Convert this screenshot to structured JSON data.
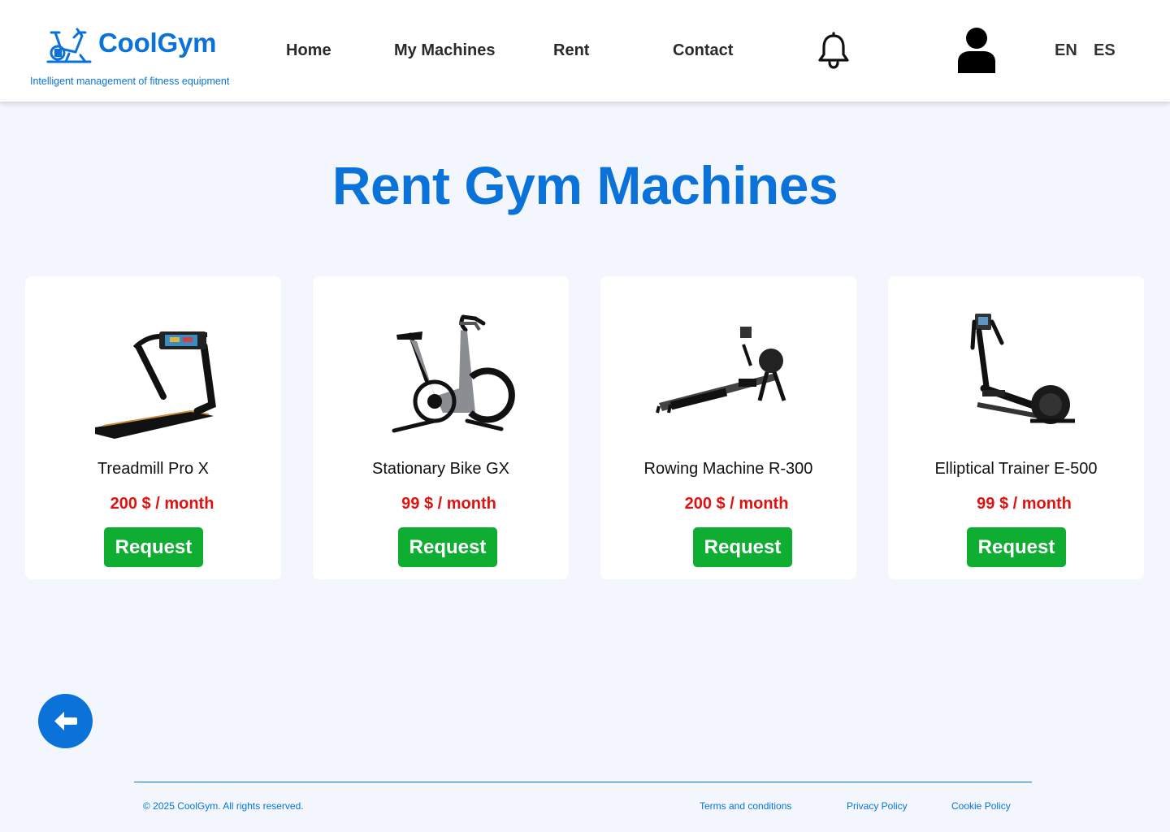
{
  "brand": {
    "name": "CoolGym",
    "tagline": "Intelligent management of fitness equipment"
  },
  "nav": {
    "items": [
      {
        "label": "Home"
      },
      {
        "label": "My Machines"
      },
      {
        "label": "Rent"
      },
      {
        "label": "Contact"
      }
    ]
  },
  "header_icons": {
    "notifications": "bell-icon",
    "profile": "user-icon"
  },
  "languages": [
    "EN",
    "ES"
  ],
  "page": {
    "title": "Rent Gym Machines"
  },
  "machines": [
    {
      "name": "Treadmill Pro X",
      "price": "200 $ / month",
      "action": "Request",
      "image": "treadmill"
    },
    {
      "name": "Stationary Bike GX",
      "price": "99 $ / month",
      "action": "Request",
      "image": "stationary-bike"
    },
    {
      "name": "Rowing Machine R-300",
      "price": "200 $ / month",
      "action": "Request",
      "image": "rowing-machine"
    },
    {
      "name": "Elliptical Trainer E-500",
      "price": "99 $ / month",
      "action": "Request",
      "image": "elliptical-trainer"
    }
  ],
  "back_button": {
    "icon": "arrow-left-icon"
  },
  "footer": {
    "copyright": "© 2025 CoolGym. All rights reserved.",
    "links": [
      {
        "label": "Terms and conditions"
      },
      {
        "label": "Privacy Policy"
      },
      {
        "label": "Cookie Policy"
      }
    ]
  },
  "colors": {
    "primary": "#0a72d9",
    "price": "#e0120f",
    "button": "#0fae33",
    "background": "#f3f7fd"
  }
}
